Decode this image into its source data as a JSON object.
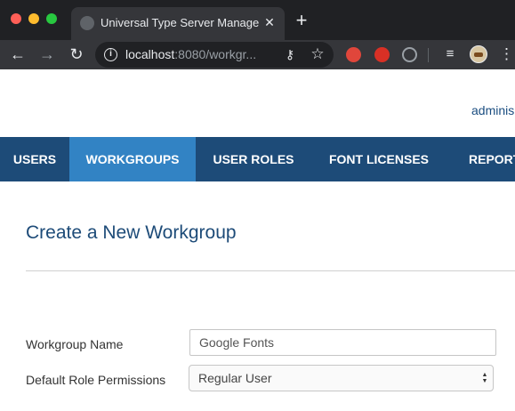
{
  "browser": {
    "tab_title": "Universal Type Server Manager",
    "url_host": "localhost",
    "url_path": ":8080/workgr...",
    "icons": {
      "favicon": "globe-icon",
      "close": "close-icon",
      "new_tab": "plus-icon",
      "back": "arrow-left-icon",
      "forward": "arrow-right-icon",
      "reload": "reload-icon",
      "site_info": "info-icon",
      "passwords": "key-icon",
      "bookmark": "star-icon",
      "media": "media-control-icon",
      "menu": "kebab-icon"
    }
  },
  "header": {
    "user_link": "adminis"
  },
  "nav": {
    "items": [
      {
        "label": "USERS",
        "active": false
      },
      {
        "label": "WORKGROUPS",
        "active": true
      },
      {
        "label": "USER ROLES",
        "active": false
      },
      {
        "label": "FONT LICENSES",
        "active": false
      },
      {
        "label": "REPORTS",
        "active": false
      }
    ],
    "colors": {
      "bar": "#1d4b78",
      "active": "#3283c4"
    }
  },
  "form": {
    "title": "Create a New Workgroup",
    "name_label": "Workgroup Name",
    "name_value": "Google Fonts",
    "role_label": "Default Role Permissions",
    "role_value": "Regular User"
  }
}
